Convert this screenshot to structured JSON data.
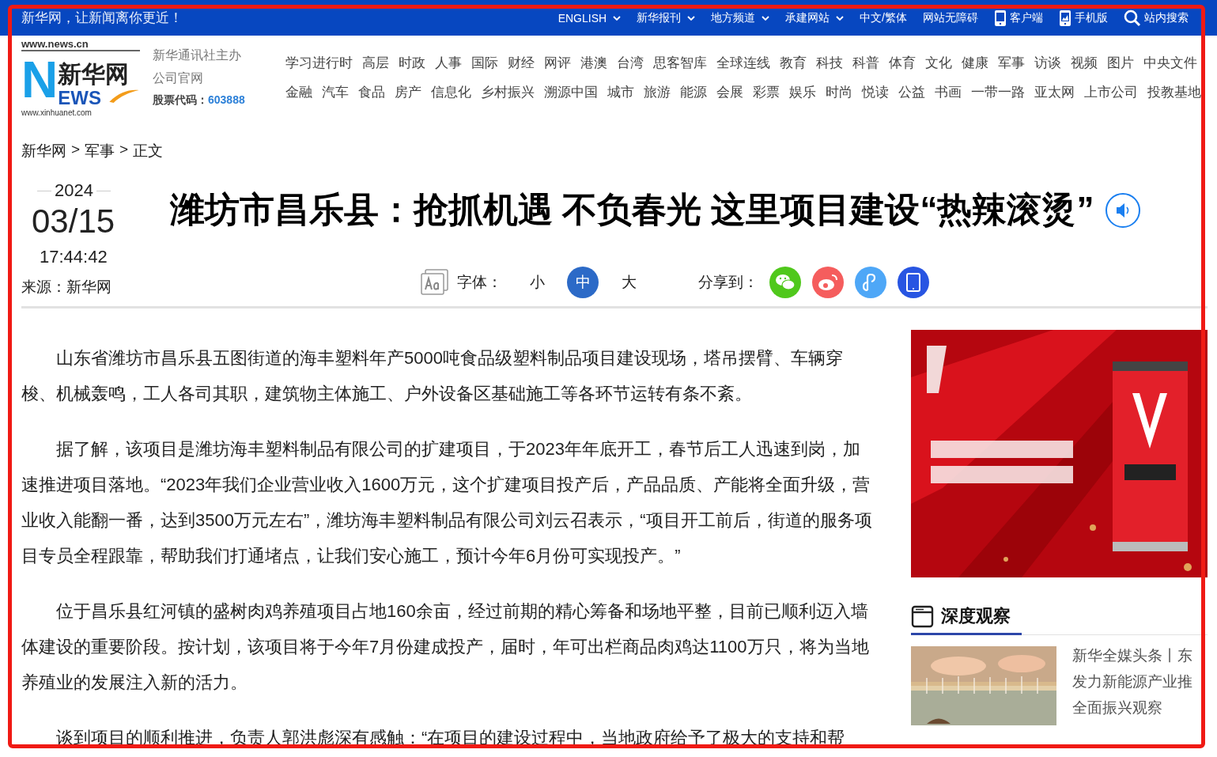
{
  "top_bar": {
    "slogan": "新华网，让新闻离你更近！",
    "links": [
      {
        "label": "ENGLISH",
        "kind": "dropdown"
      },
      {
        "label": "新华报刊",
        "kind": "dropdown"
      },
      {
        "label": "地方频道",
        "kind": "dropdown"
      },
      {
        "label": "承建网站",
        "kind": "dropdown"
      },
      {
        "label": "中文/繁体",
        "kind": "link"
      },
      {
        "label": "网站无障碍",
        "kind": "link"
      },
      {
        "label": "客户端",
        "kind": "app"
      },
      {
        "label": "手机版",
        "kind": "mobile"
      },
      {
        "label": "站内搜索",
        "kind": "search"
      }
    ]
  },
  "header": {
    "logo": {
      "domain": "www.news.cn",
      "name": "新华网",
      "letters": "EWS",
      "initial": "N",
      "url": "www.xinhuanet.com"
    },
    "org_lines": [
      "新华通讯社主办",
      "公司官网"
    ],
    "stock_label": "股票代码：",
    "stock_code": "603888",
    "channels": [
      [
        "学习进行时",
        "高层",
        "时政",
        "人事",
        "国际",
        "财经",
        "网评",
        "港澳",
        "台湾",
        "思客智库",
        "全球连线",
        "教育",
        "科技",
        "科普",
        "体育",
        "文化",
        "健康",
        "军事",
        "访谈",
        "视频",
        "图片",
        "中央文件"
      ],
      [
        "金融",
        "汽车",
        "食品",
        "房产",
        "信息化",
        "乡村振兴",
        "溯源中国",
        "城市",
        "旅游",
        "能源",
        "会展",
        "彩票",
        "娱乐",
        "时尚",
        "悦读",
        "公益",
        "书画",
        "一带一路",
        "亚太网",
        "上市公司",
        "投教基地"
      ]
    ]
  },
  "breadcrumb": {
    "separator": ">",
    "items": [
      "新华网",
      "军事",
      "正文"
    ]
  },
  "article": {
    "year": "2024",
    "date": "03/15",
    "time": "17:44:42",
    "source": "来源：新华网",
    "title": "潍坊市昌乐县：抢抓机遇 不负春光 这里项目建设“热辣滚烫”",
    "font_label": "字体：",
    "font_sizes": [
      {
        "label": "小",
        "selected": false
      },
      {
        "label": "中",
        "selected": true
      },
      {
        "label": "大",
        "selected": false
      }
    ],
    "share_label": "分享到：",
    "share": [
      {
        "kind": "wechat",
        "color": "#50c81c"
      },
      {
        "kind": "weibo",
        "color": "#f55d5d"
      },
      {
        "kind": "miniapp",
        "color": "#4ea7f7"
      },
      {
        "kind": "mobile",
        "color": "#2855e2"
      }
    ],
    "paragraphs": [
      "山东省潍坊市昌乐县五图街道的海丰塑料年产5000吨食品级塑料制品项目建设现场，塔吊摆臂、车辆穿梭、机械轰鸣，工人各司其职，建筑物主体施工、户外设备区基础施工等各环节运转有条不紊。",
      "据了解，该项目是潍坊海丰塑料制品有限公司的扩建项目，于2023年年底开工，春节后工人迅速到岗，加速推进项目落地。“2023年我们企业营业收入1600万元，这个扩建项目投产后，产品品质、产能将全面升级，营业收入能翻一番，达到3500万元左右”，潍坊海丰塑料制品有限公司刘云召表示，“项目开工前后，街道的服务项目专员全程跟靠，帮助我们打通堵点，让我们安心施工，预计今年6月份可实现投产。”",
      "位于昌乐县红河镇的盛树肉鸡养殖项目占地160余亩，经过前期的精心筹备和场地平整，目前已顺利迈入墙体建设的重要阶段。按计划，该项目将于今年7月份建成投产，届时，年可出栏商品肉鸡达1100万只，将为当地养殖业的发展注入新的活力。",
      "谈到项目的顺利推进，负责人郭洪彪深有感触：“在项目的建设过程中，当地政府给予了极大的支持和帮"
    ]
  },
  "sidebar": {
    "ad": {
      "kind": "picture"
    },
    "section_title": "深度观察",
    "feature": {
      "image": {
        "kind": "picture"
      },
      "lines": [
        "新华全媒头条丨东",
        "发力新能源产业推",
        "全面振兴观察"
      ]
    }
  }
}
